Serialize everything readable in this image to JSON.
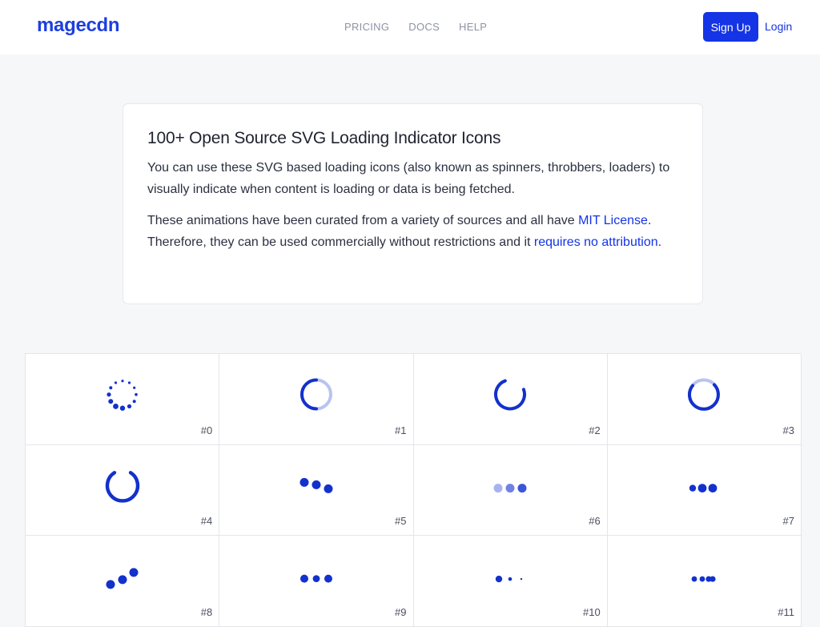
{
  "header": {
    "logo": "magecdn",
    "nav": [
      {
        "label": "PRICING",
        "name": "nav-pricing"
      },
      {
        "label": "DOCS",
        "name": "nav-docs"
      },
      {
        "label": "HELP",
        "name": "nav-help"
      }
    ],
    "signup_label": "Sign Up",
    "login_label": "Login"
  },
  "intro": {
    "title": "100+ Open Source SVG Loading Indicator Icons",
    "paragraph1": "You can use these SVG based loading icons (also known as spinners, throbbers, loaders) to visually indicate when content is loading or data is being fetched.",
    "paragraph2_before": "These animations have been curated from a variety of sources and all have ",
    "mit_link": "MIT License",
    "paragraph2_middle": ". Therefore, they can be used commercially without restrictions and it ",
    "attribution_link": "requires no attribution",
    "paragraph2_after": "."
  },
  "colors": {
    "accent": "#1434e6",
    "icon": "#1331cc",
    "icon_light": "#b9c3f0"
  },
  "loaders": [
    {
      "label": "#0",
      "icon": "dotted-circle-spinner-icon"
    },
    {
      "label": "#1",
      "icon": "ring-arc-spinner-icon"
    },
    {
      "label": "#2",
      "icon": "open-arc-spinner-icon"
    },
    {
      "label": "#3",
      "icon": "ring-spinner-icon"
    },
    {
      "label": "#4",
      "icon": "horseshoe-spinner-icon"
    },
    {
      "label": "#5",
      "icon": "falling-dots-icon"
    },
    {
      "label": "#6",
      "icon": "fading-dots-icon"
    },
    {
      "label": "#7",
      "icon": "pulse-dots-icon"
    },
    {
      "label": "#8",
      "icon": "rising-dots-icon"
    },
    {
      "label": "#9",
      "icon": "three-dots-icon"
    },
    {
      "label": "#10",
      "icon": "shrinking-dots-icon"
    },
    {
      "label": "#11",
      "icon": "bunched-dots-icon"
    }
  ]
}
